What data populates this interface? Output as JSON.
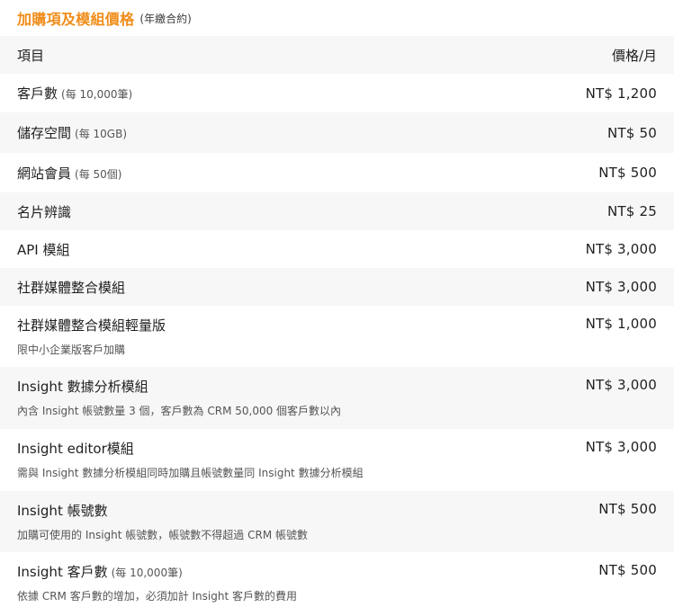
{
  "header": {
    "title": "加購項及模組價格",
    "subtitle": "(年繳合約)"
  },
  "table": {
    "col_item": "項目",
    "col_price": "價格/月",
    "rows": [
      {
        "name": "客戶數",
        "unit": "(每 10,000筆)",
        "price": "NT$ 1,200"
      },
      {
        "name": "儲存空間",
        "unit": "(每 10GB)",
        "price": "NT$ 50"
      },
      {
        "name": "網站會員",
        "unit": "(每 50個)",
        "price": "NT$ 500"
      },
      {
        "name": "名片辨識",
        "price": "NT$ 25"
      },
      {
        "name": "API 模組",
        "price": "NT$ 3,000"
      },
      {
        "name": "社群媒體整合模組",
        "price": "NT$ 3,000"
      },
      {
        "name": "社群媒體整合模組輕量版",
        "note": "限中小企業版客戶加購",
        "price": "NT$ 1,000"
      },
      {
        "name": "Insight 數據分析模組",
        "note": "內含 Insight 帳號數量 3 個，客戶數為 CRM 50,000 個客戶數以內",
        "price": "NT$ 3,000"
      },
      {
        "name": "Insight editor模組",
        "note": "需與 Insight 數據分析模組同時加購且帳號數量同 Insight 數據分析模組",
        "price": "NT$ 3,000"
      },
      {
        "name": "Insight 帳號數",
        "note": "加購可使用的 Insight 帳號數，帳號數不得超過 CRM 帳號數",
        "price": "NT$ 500"
      },
      {
        "name": "Insight 客戶數",
        "unit": "(每 10,000筆)",
        "note": "依據 CRM 客戶數的增加，必須加計 Insight 客戶數的費用",
        "price": "NT$ 500"
      }
    ]
  }
}
